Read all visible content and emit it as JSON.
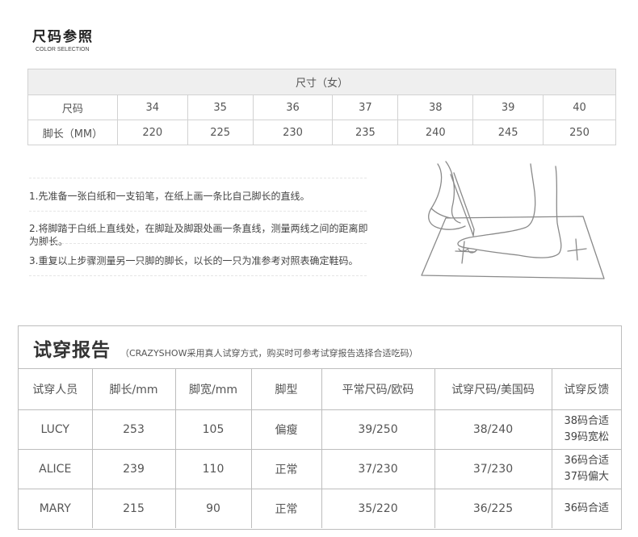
{
  "header": {
    "title": "尺码参照",
    "subtitle": "COLOR SELECTION"
  },
  "size_table": {
    "caption": "尺寸（女）",
    "row1_label": "尺码",
    "sizes": [
      "34",
      "35",
      "36",
      "37",
      "38",
      "39",
      "40"
    ],
    "row2_label": "脚长（MM）",
    "lengths": [
      "220",
      "225",
      "230",
      "235",
      "240",
      "245",
      "250"
    ]
  },
  "instructions": [
    "1.先准备一张白纸和一支铅笔，在纸上画一条比自己脚长的直线。",
    "2.将脚踏于白纸上直线处，在脚趾及脚跟处画一条直线，测量两线之间的距离即为脚长。",
    "3.重复以上步骤测量另一只脚的脚长，以长的一只为准参考对照表确定鞋码。"
  ],
  "report": {
    "title": "试穿报告",
    "note": "（CRAZYSHOW采用真人试穿方式，购买时可参考试穿报告选择合适吃码）",
    "headers": [
      "试穿人员",
      "脚长/mm",
      "脚宽/mm",
      "脚型",
      "平常尺码/欧码",
      "试穿尺码/美国码",
      "试穿反馈"
    ],
    "rows": [
      {
        "name": "LUCY",
        "length": "253",
        "width": "105",
        "type": "偏瘦",
        "usual": "39/250",
        "tried": "38/240",
        "feedback1": "38码合适",
        "feedback2": "39码宽松"
      },
      {
        "name": "ALICE",
        "length": "239",
        "width": "110",
        "type": "正常",
        "usual": "37/230",
        "tried": "37/230",
        "feedback1": "36码合适",
        "feedback2": "37码偏大"
      },
      {
        "name": "MARY",
        "length": "215",
        "width": "90",
        "type": "正常",
        "usual": "35/220",
        "tried": "36/225",
        "feedback1": "36码合适",
        "feedback2": ""
      }
    ]
  },
  "illustration": {
    "icon": "foot-measure-icon"
  }
}
